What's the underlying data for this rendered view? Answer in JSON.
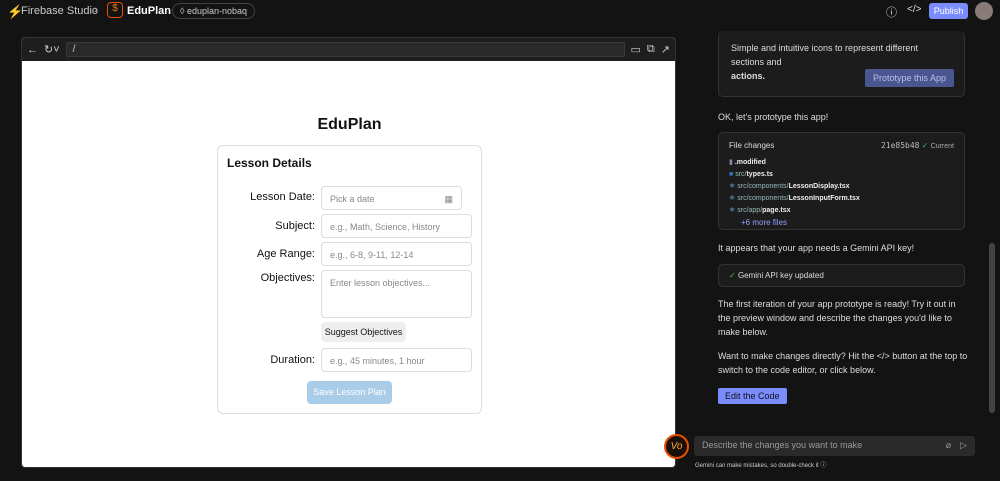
{
  "header": {
    "brand": "Firebase Studio",
    "app_name": "EduPlan",
    "workspace": "eduplan-nobaq",
    "publish": "Publish"
  },
  "browser": {
    "url": "/"
  },
  "app": {
    "title": "EduPlan",
    "card_title": "Lesson Details",
    "fields": [
      {
        "label": "Lesson Date:",
        "placeholder": "Pick a date"
      },
      {
        "label": "Subject:",
        "placeholder": "e.g., Math, Science, History"
      },
      {
        "label": "Age Range:",
        "placeholder": "e.g., 6-8, 9-11, 12-14"
      },
      {
        "label": "Objectives:",
        "placeholder": "Enter lesson objectives..."
      },
      {
        "label": "Duration:",
        "placeholder": "e.g., 45 minutes, 1 hour"
      }
    ],
    "suggest": "Suggest Objectives",
    "save": "Save Lesson Plan"
  },
  "chat": {
    "prev_text": "Simple and intuitive icons to represent different sections and",
    "prev_bold": "actions.",
    "prototype_btn": "Prototype this App",
    "msg1": "OK, let's prototype this app!",
    "file_changes": {
      "title": "File changes",
      "hash": "21e85b48",
      "status": "Current",
      "files": [
        {
          "dir": "",
          "name": ".modified"
        },
        {
          "dir": "src/",
          "name": "types.ts"
        },
        {
          "dir": "src/components/",
          "name": "LessonDisplay.tsx"
        },
        {
          "dir": "src/components/",
          "name": "LessonInputForm.tsx"
        },
        {
          "dir": "src/app/",
          "name": "page.tsx"
        }
      ],
      "more": "+6 more files"
    },
    "msg2": "It appears that your app needs a Gemini API key!",
    "api_status": "Gemini API key updated",
    "msg3": "The first iteration of your app prototype is ready! Try it out in the preview window and describe the changes you'd like to make below.",
    "msg4": "Want to make changes directly? Hit the </> button at the top to switch to the code editor, or click below.",
    "edit_btn": "Edit the Code"
  },
  "input": {
    "placeholder": "Describe the changes you want to make",
    "disclaimer": "Gemini can make mistakes, so double-check it"
  }
}
